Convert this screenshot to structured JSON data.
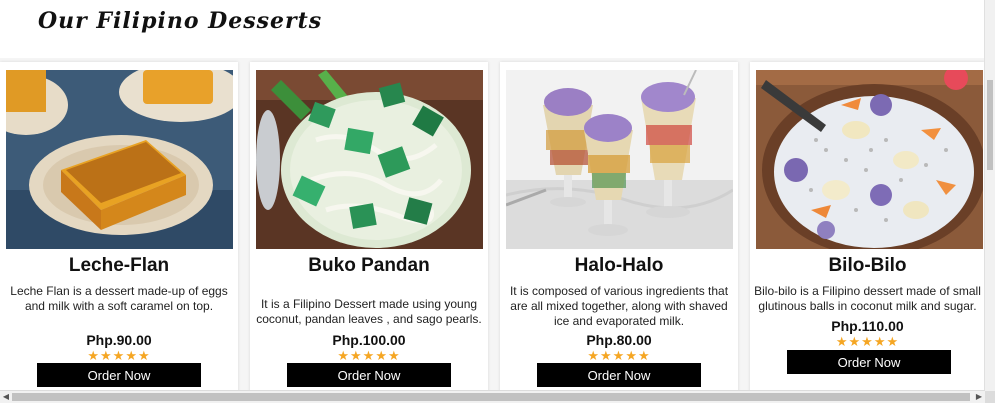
{
  "header": {
    "title": "Our Filipino Desserts"
  },
  "products": [
    {
      "name": "Leche-Flan",
      "description": "Leche Flan is a dessert made-up of eggs and milk with a soft caramel on top.",
      "price": "Php.90.00",
      "stars": "★★★★★",
      "button": "Order Now",
      "icon": "leche-flan-image"
    },
    {
      "name": "Buko Pandan",
      "description": "It is a Filipino Dessert made using young coconut, pandan leaves , and sago pearls.",
      "price": "Php.100.00",
      "stars": "★★★★★",
      "button": "Order Now",
      "icon": "buko-pandan-image"
    },
    {
      "name": "Halo-Halo",
      "description": "It is composed of various ingredients that are all mixed together, along with shaved ice and evaporated milk.",
      "price": "Php.80.00",
      "stars": "★★★★★",
      "button": "Order Now",
      "icon": "halo-halo-image"
    },
    {
      "name": "Bilo-Bilo",
      "description": "Bilo-bilo is a Filipino dessert made of small glutinous balls in coconut milk and sugar.",
      "price": "Php.110.00",
      "stars": "★★★★★",
      "button": "Order Now",
      "icon": "bilo-bilo-image"
    }
  ],
  "colors": {
    "star": "#f5a623",
    "button": "#000000",
    "button_text": "#ffffff"
  },
  "scrollbar": {
    "left_arrow": "◀",
    "right_arrow": "▶"
  }
}
